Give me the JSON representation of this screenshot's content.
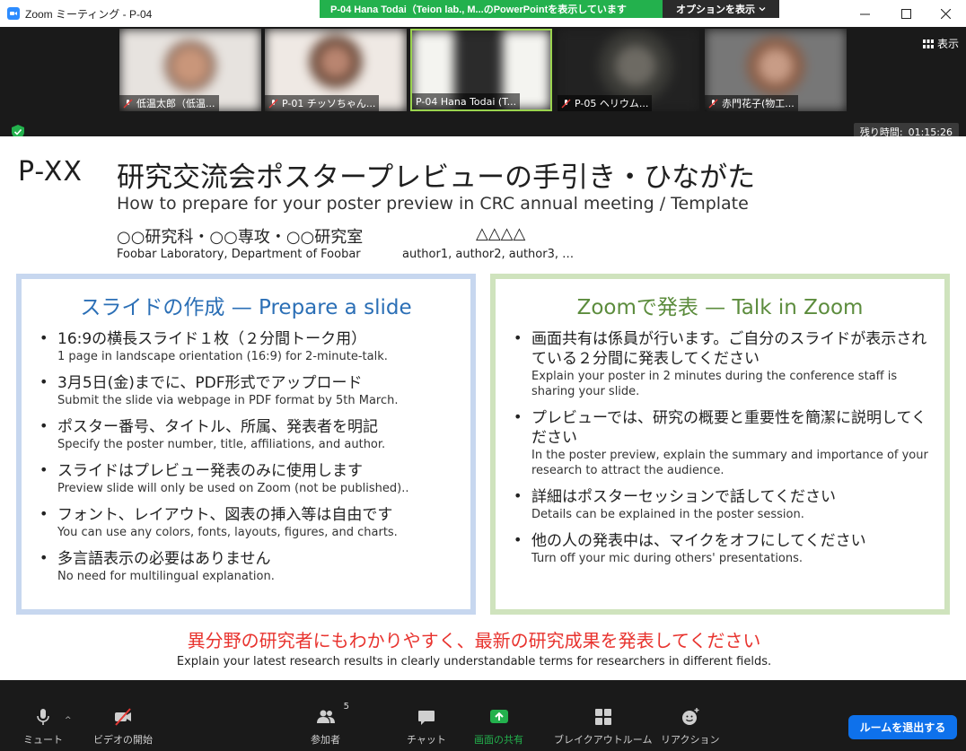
{
  "window": {
    "title": "Zoom ミーティング - P-04",
    "share_banner": "P-04  Hana Todai（Teion lab., M...のPowerPointを表示しています",
    "options_label": "オプションを表示"
  },
  "video": {
    "view_label": "表示",
    "remaining_label": "残り時間:",
    "remaining_time": "01:15:26",
    "tiles": [
      {
        "name": "低温太郎（低温..."
      },
      {
        "name": "P-01 チッソちゃん..."
      },
      {
        "name": "P-04 Hana Todai (T..."
      },
      {
        "name": "P-05 ヘリウム..."
      },
      {
        "name": "赤門花子(物工..."
      }
    ]
  },
  "slide": {
    "poster_number": "P-XX",
    "title_ja": "研究交流会ポスタープレビューの手引き・ひながた",
    "title_en": "How to prepare for your poster preview in CRC annual meeting / Template",
    "affiliation_ja": "○○研究科・○○専攻・○○研究室",
    "authors_ja": "△△△△",
    "affiliation_en": "Foobar Laboratory, Department of Foobar",
    "authors_en": "author1, author2, author3, …",
    "left_panel": {
      "heading": "スライドの作成 — Prepare a slide",
      "items": [
        {
          "ja": "16:9の横長スライド１枚（２分間トーク用）",
          "en": "1 page in landscape orientation (16:9) for 2-minute-talk."
        },
        {
          "ja": "3月5日(金)までに、PDF形式でアップロード",
          "en": "Submit the slide via webpage in PDF format by 5th March."
        },
        {
          "ja": "ポスター番号、タイトル、所属、発表者を明記",
          "en": "Specify the poster number, title, affiliations, and author."
        },
        {
          "ja": "スライドはプレビュー発表のみに使用します",
          "en": "Preview slide will only be used on Zoom (not be published).."
        },
        {
          "ja": "フォント、レイアウト、図表の挿入等は自由です",
          "en": "You can use any colors, fonts, layouts, figures, and charts."
        },
        {
          "ja": "多言語表示の必要はありません",
          "en": "No need for multilingual explanation."
        }
      ]
    },
    "right_panel": {
      "heading": "Zoomで発表 — Talk in Zoom",
      "items": [
        {
          "ja": "画面共有は係員が行います。ご自分のスライドが表示されている２分間に発表してください",
          "en": "Explain your poster in 2 minutes during the conference staff is sharing your slide."
        },
        {
          "ja": "プレビューでは、研究の概要と重要性を簡潔に説明してください",
          "en": "In the poster preview, explain the summary and importance of your research to attract the audience."
        },
        {
          "ja": "詳細はポスターセッションで話してください",
          "en": "Details can be explained in the poster session."
        },
        {
          "ja": "他の人の発表中は、マイクをオフにしてください",
          "en": "Turn off your mic during others' presentations."
        }
      ]
    },
    "footer_ja": "異分野の研究者にもわかりやすく、最新の研究成果を発表してください",
    "footer_en": "Explain your latest research results in clearly understandable terms for researchers in different fields."
  },
  "toolbar": {
    "mute": "ミュート",
    "start_video": "ビデオの開始",
    "participants": "参加者",
    "participants_count": "5",
    "chat": "チャット",
    "share_screen": "画面の共有",
    "breakout_rooms": "ブレイクアウトルーム",
    "reactions": "リアクション",
    "leave_room": "ルームを退出する"
  },
  "colors": {
    "share_green": "#23b14d",
    "leave_blue": "#0e71eb",
    "left_panel_border": "#c7d7ef",
    "right_panel_border": "#cfe3bd",
    "footer_red": "#e8332e"
  }
}
